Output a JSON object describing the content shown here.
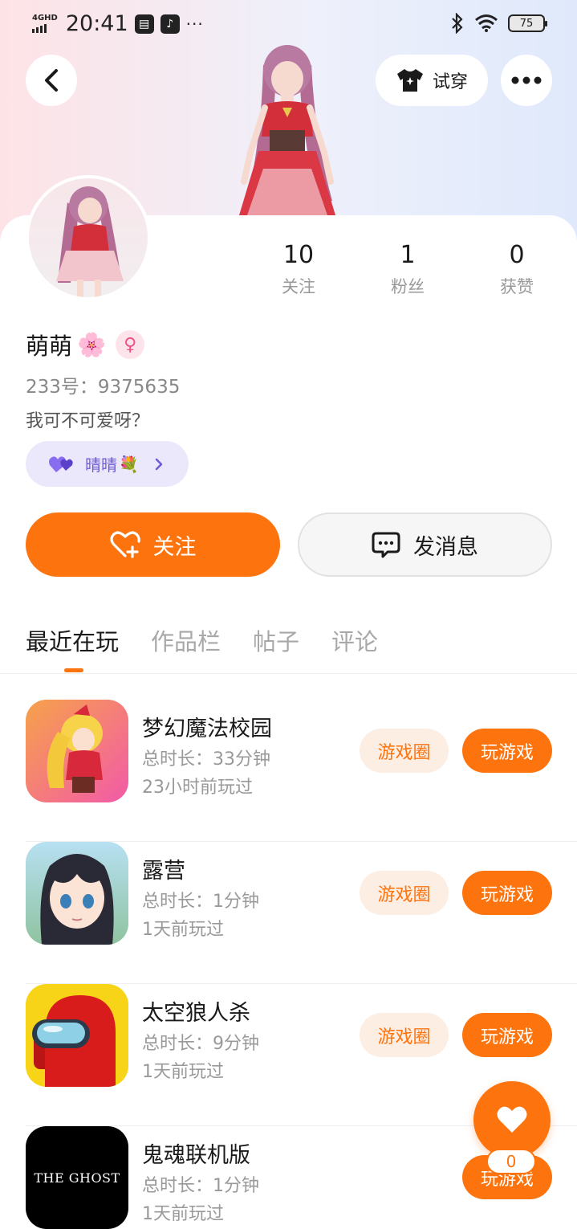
{
  "status_bar": {
    "network": "4GHD",
    "time": "20:41",
    "more": "···",
    "battery": "75"
  },
  "header": {
    "try_on_label": "试穿"
  },
  "profile": {
    "stats": [
      {
        "value": "10",
        "label": "关注"
      },
      {
        "value": "1",
        "label": "粉丝"
      },
      {
        "value": "0",
        "label": "获赞"
      }
    ],
    "nickname": "萌萌",
    "nickname_emoji": "🌸",
    "gender_icon": "female-icon",
    "account_id": "233号：9375635",
    "bio": "我可不可爱呀？",
    "cp_name": "晴晴",
    "cp_emoji": "💐"
  },
  "actions": {
    "follow_label": "关注",
    "message_label": "发消息"
  },
  "tabs": [
    "最近在玩",
    "作品栏",
    "帖子",
    "评论"
  ],
  "games": [
    {
      "title": "梦幻魔法校园",
      "duration": "总时长：33分钟",
      "last_played": "23小时前玩过",
      "circle_label": "游戏圈",
      "play_label": "玩游戏"
    },
    {
      "title": "露营",
      "duration": "总时长：1分钟",
      "last_played": "1天前玩过",
      "circle_label": "游戏圈",
      "play_label": "玩游戏"
    },
    {
      "title": "太空狼人杀",
      "duration": "总时长：9分钟",
      "last_played": "1天前玩过",
      "circle_label": "游戏圈",
      "play_label": "玩游戏"
    },
    {
      "title": "鬼魂联机版",
      "duration": "总时长：1分钟",
      "last_played": "1天前玩过",
      "icon_text": "THE GHOST",
      "play_label": "玩游戏"
    }
  ],
  "fab": {
    "icon": "heart-icon",
    "count": "0"
  },
  "colors": {
    "accent": "#fd740f",
    "accent_light": "#fdeee4",
    "cp_pill_bg": "#ece8fb",
    "female": "#f0508a"
  }
}
